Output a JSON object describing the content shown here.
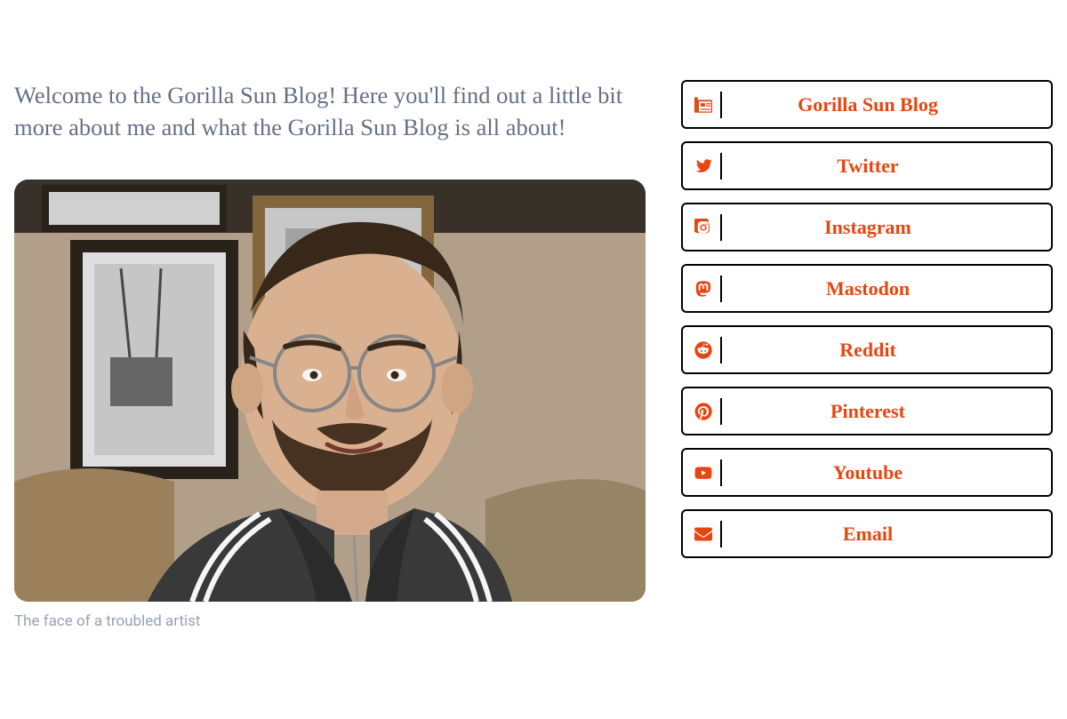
{
  "intro": "Welcome to the Gorilla Sun Blog! Here you'll find out a little bit more about me and what the Gorilla Sun Blog is all about!",
  "photo": {
    "caption": "The face of a troubled artist",
    "alt": "Portrait photo of the author"
  },
  "links": [
    {
      "icon": "newspaper-icon",
      "label": "Gorilla Sun Blog"
    },
    {
      "icon": "twitter-icon",
      "label": "Twitter"
    },
    {
      "icon": "instagram-icon",
      "label": "Instagram"
    },
    {
      "icon": "mastodon-icon",
      "label": "Mastodon"
    },
    {
      "icon": "reddit-icon",
      "label": "Reddit"
    },
    {
      "icon": "pinterest-icon",
      "label": "Pinterest"
    },
    {
      "icon": "youtube-icon",
      "label": "Youtube"
    },
    {
      "icon": "email-icon",
      "label": "Email"
    }
  ],
  "accent": "#e84610"
}
